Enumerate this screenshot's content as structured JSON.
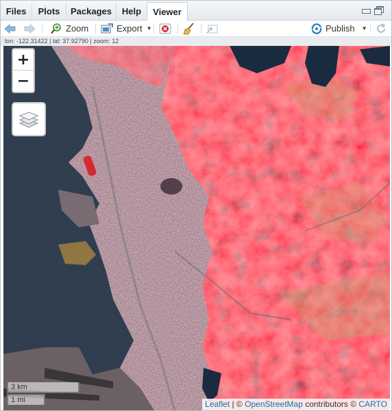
{
  "tabs": [
    {
      "label": "Files"
    },
    {
      "label": "Plots"
    },
    {
      "label": "Packages"
    },
    {
      "label": "Help"
    },
    {
      "label": "Viewer"
    }
  ],
  "active_tab": "Viewer",
  "toolbar": {
    "zoom_label": "Zoom",
    "export_label": "Export",
    "publish_label": "Publish"
  },
  "status": {
    "text": "lon: -122.31422 | lat: 37.92790 | zoom: 12"
  },
  "map": {
    "zoom_in_label": "+",
    "zoom_out_label": "−",
    "scale_km": "3 km",
    "scale_mi": "1 mi",
    "attribution": {
      "leaflet": "Leaflet",
      "sep": " | © ",
      "osm": "OpenStreetMap",
      "contributors": " contributors © ",
      "carto": "CARTO"
    }
  },
  "colors": {
    "water": "#263a4d",
    "urban": "#5d4a50",
    "vegetation": "#c5202d",
    "link": "#0078a8",
    "publish_icon": "#1f7fc0"
  }
}
